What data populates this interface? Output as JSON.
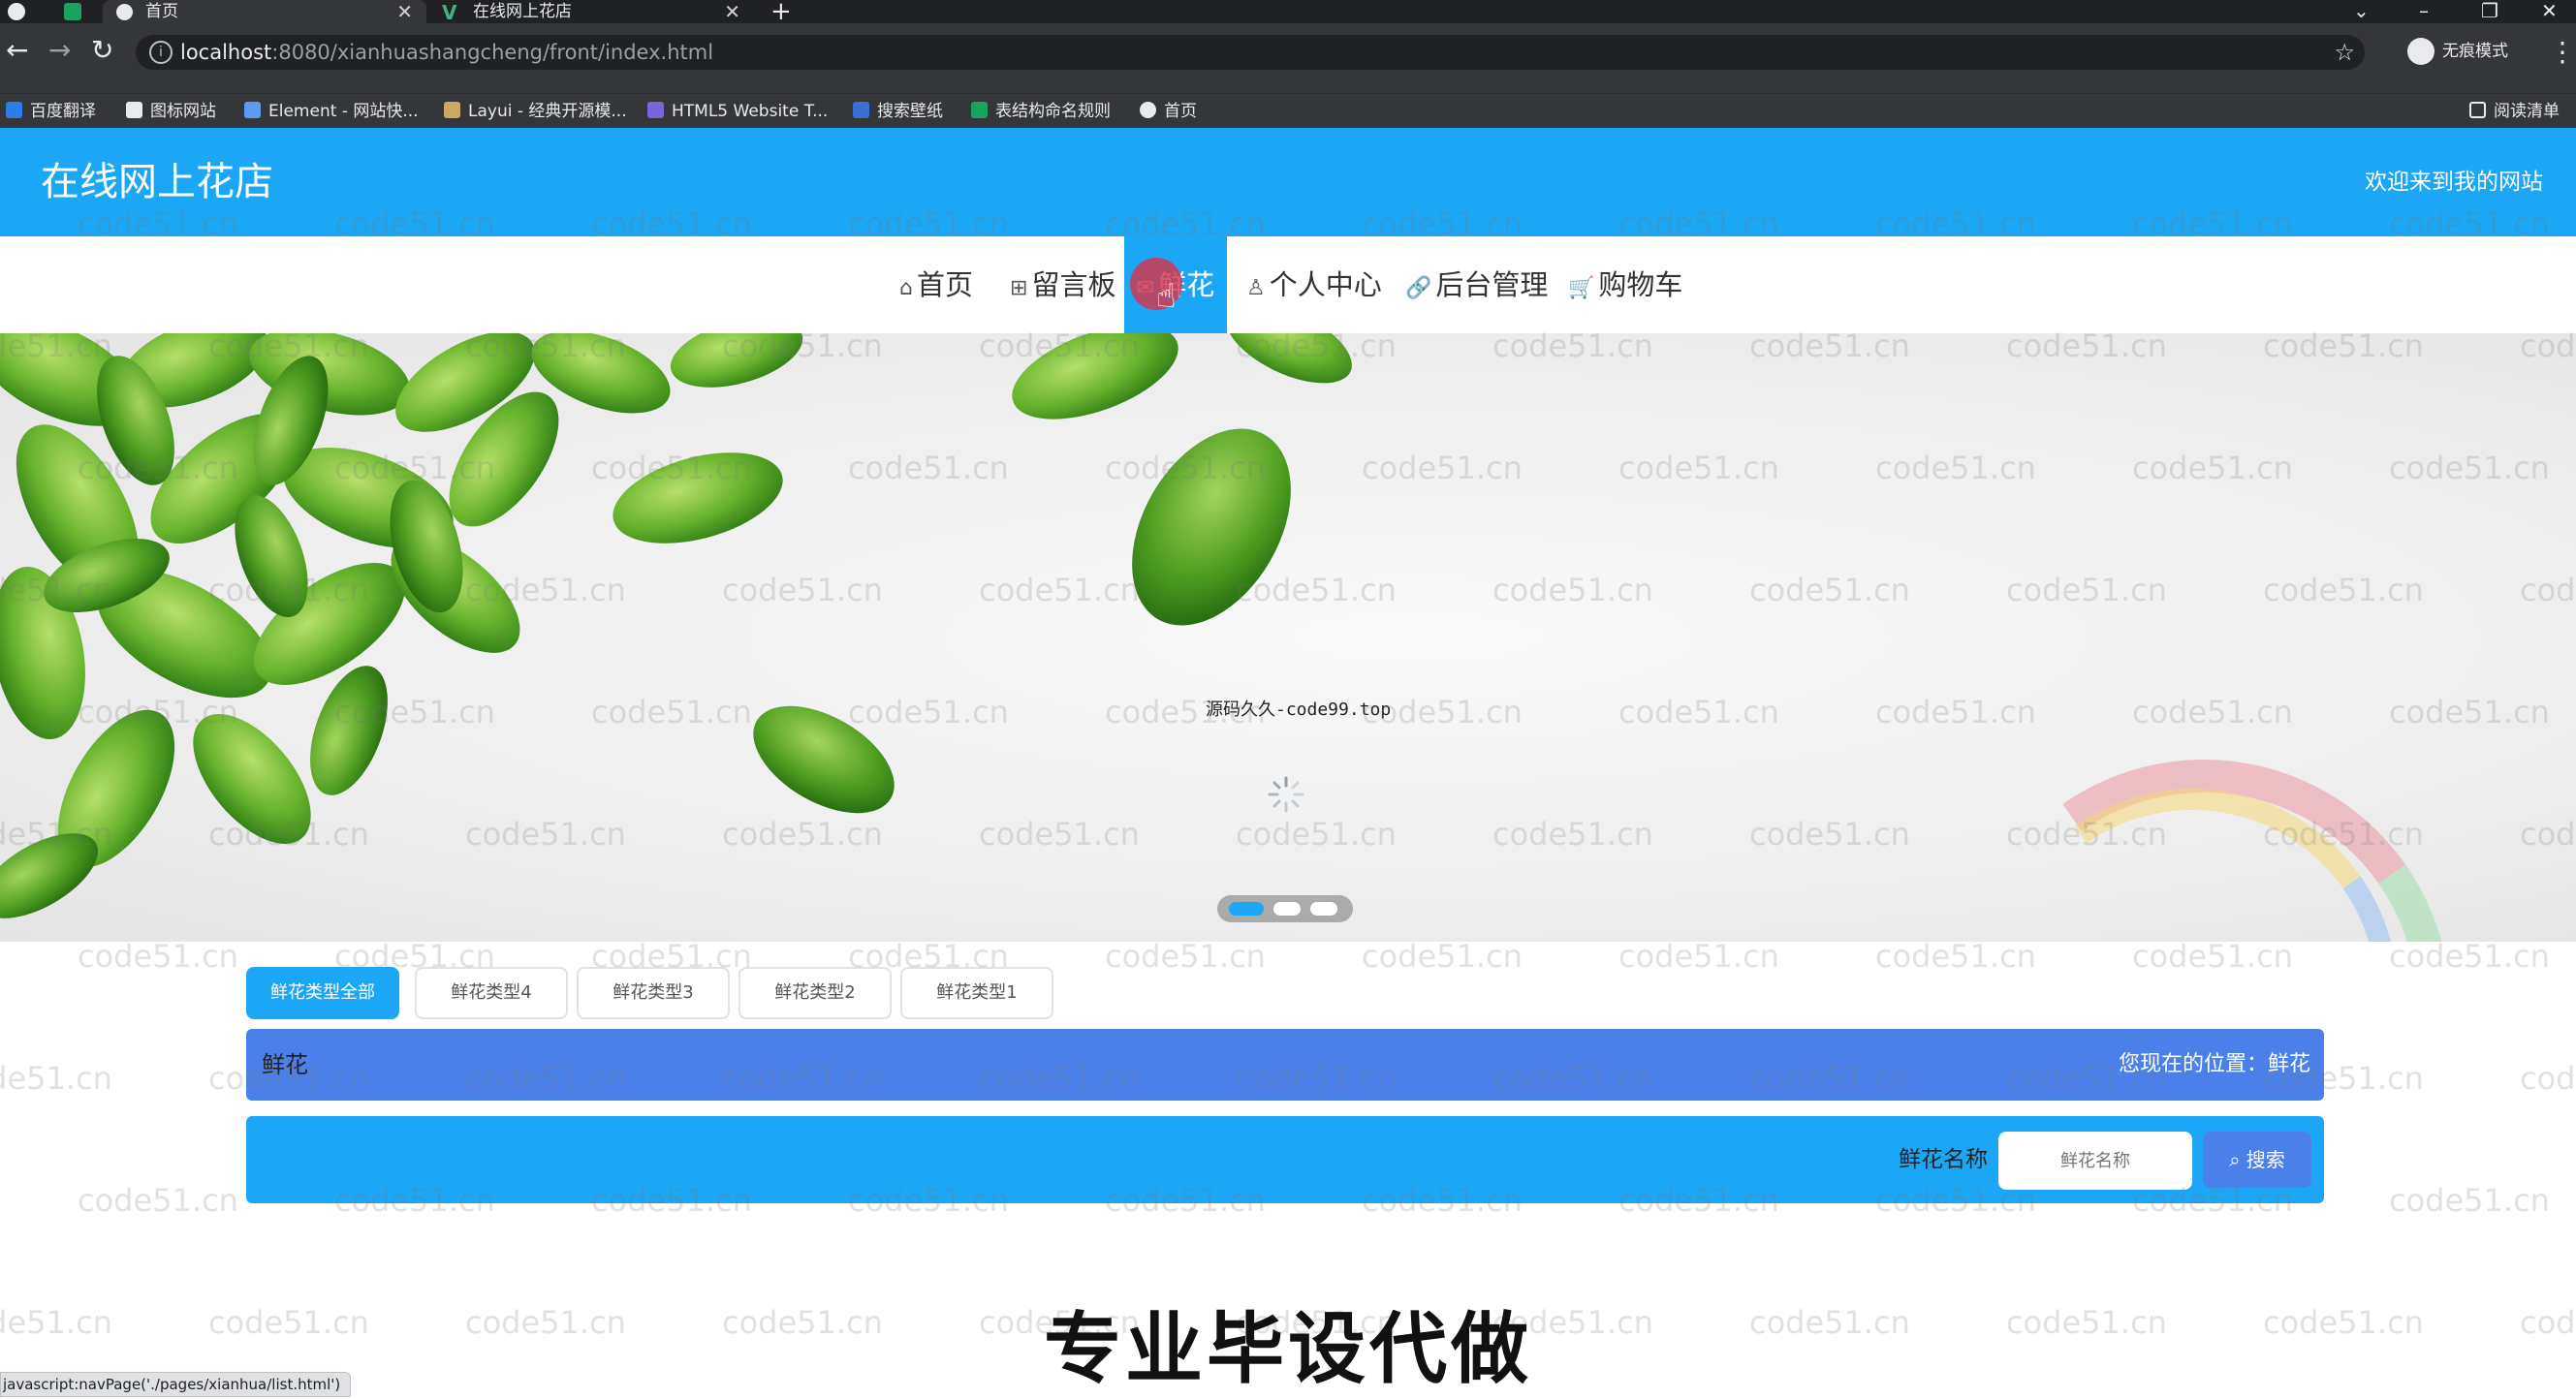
{
  "browser": {
    "tabs": [
      {
        "title": "首页",
        "active": true
      },
      {
        "title": "在线网上花店",
        "active": false
      }
    ],
    "new_tab": "+",
    "window_controls": [
      "⌄",
      "–",
      "❐",
      "✕"
    ],
    "url_host": "localhost",
    "url_path": ":8080/xianhuashangcheng/front/index.html",
    "incognito_label": "无痕模式",
    "bookmarks": [
      "百度翻译",
      "图标网站",
      "Element - 网站快...",
      "Layui - 经典开源模...",
      "HTML5 Website T...",
      "搜索壁纸",
      "表结构命名规则",
      "首页"
    ],
    "reading_list": "阅读清单",
    "status_url": "javascript:navPage('./pages/xianhua/list.html')"
  },
  "header": {
    "site_title": "在线网上花店",
    "welcome": "欢迎来到我的网站"
  },
  "nav": [
    {
      "label": "首页",
      "icon": "home-icon",
      "glyph": "⌂"
    },
    {
      "label": "留言板",
      "icon": "board-icon",
      "glyph": "⊞"
    },
    {
      "label": "鲜花",
      "icon": "mail-icon",
      "glyph": "✉",
      "active": true
    },
    {
      "label": "个人中心",
      "icon": "user-icon",
      "glyph": "♙"
    },
    {
      "label": "后台管理",
      "icon": "link-icon",
      "glyph": "🔗"
    },
    {
      "label": "购物车",
      "icon": "cart-icon",
      "glyph": "🛒"
    }
  ],
  "banner": {
    "caption": "源码久久-code99.top",
    "slide_count": 3,
    "active_slide": 1
  },
  "watermark_text": "code51.cn",
  "category_tabs": [
    "鲜花类型全部",
    "鲜花类型4",
    "鲜花类型3",
    "鲜花类型2",
    "鲜花类型1"
  ],
  "breadcrumb": {
    "title": "鲜花",
    "location_label": "您现在的位置：",
    "location_value": "鲜花"
  },
  "search": {
    "label": "鲜花名称",
    "placeholder": "鲜花名称",
    "button": "搜索"
  },
  "overlay_caption": "专业毕设代做",
  "colors": {
    "primary": "#1ca7f6",
    "breadcrumb": "#4b80ea"
  }
}
